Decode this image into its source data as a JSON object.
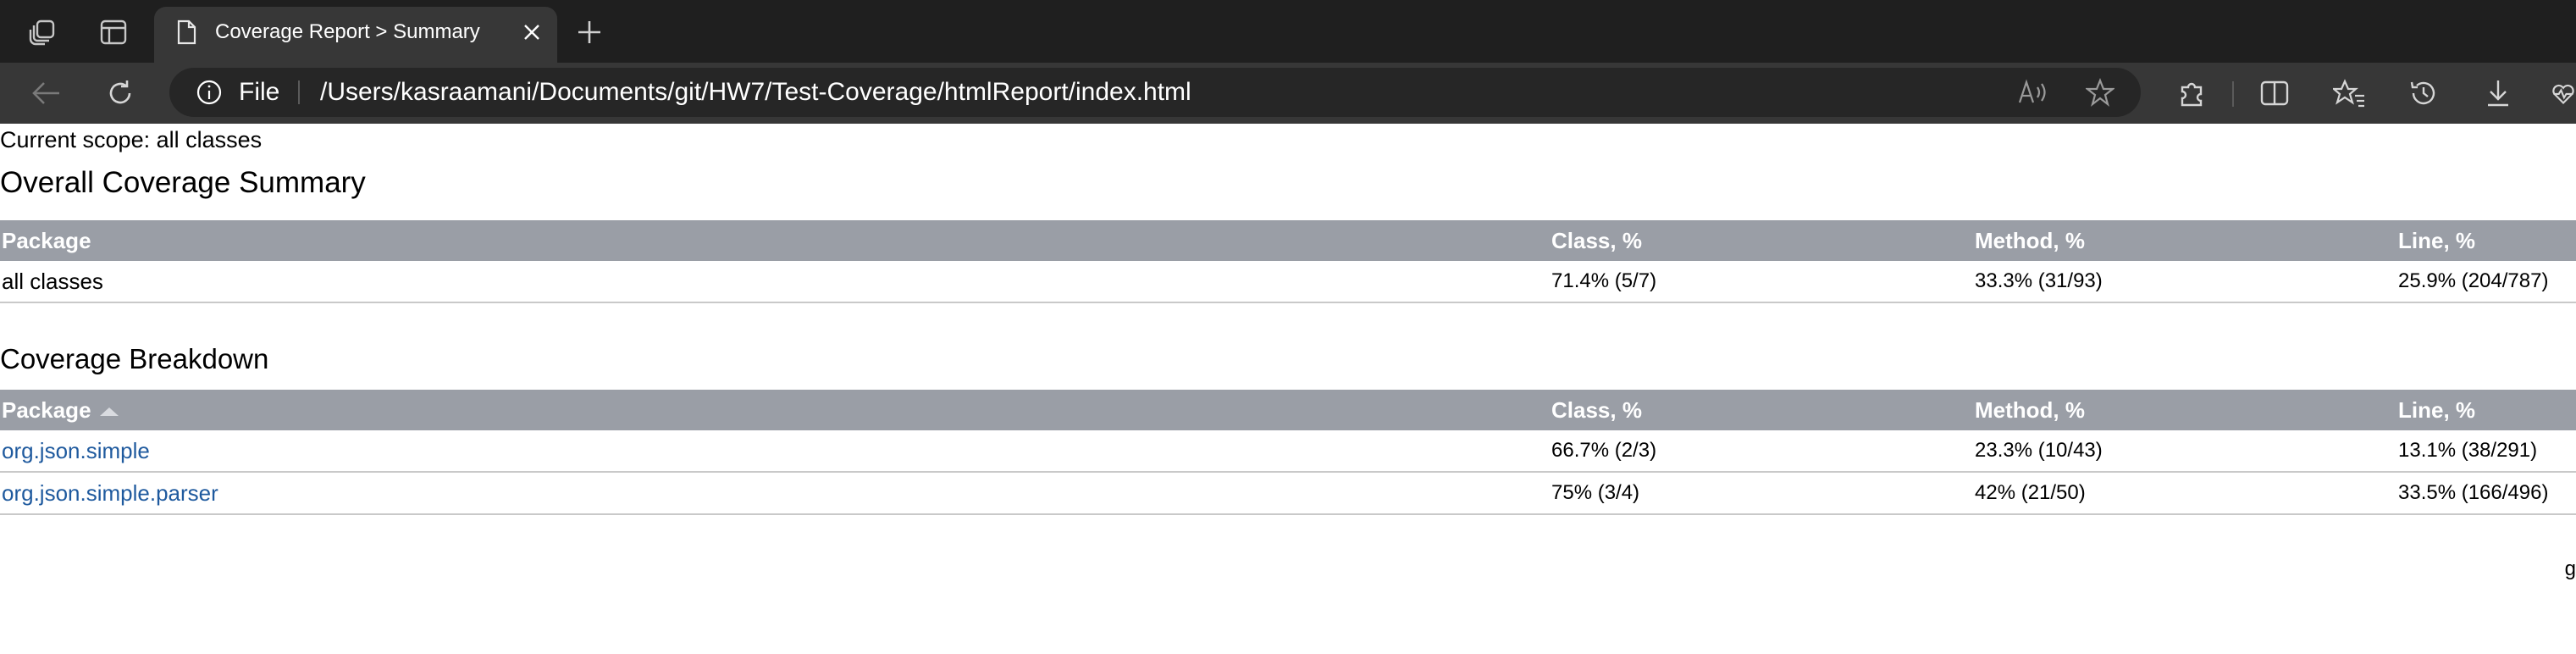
{
  "browser": {
    "tab_title": "Coverage Report > Summary",
    "address_scheme_label": "File",
    "address_url": "/Users/kasraamani/Documents/git/HW7/Test-Coverage/htmlReport/index.html",
    "icons": [
      "workspaces-icon",
      "tab-actions-icon",
      "page-icon",
      "close-icon",
      "new-tab-icon",
      "back-icon",
      "refresh-icon",
      "info-icon",
      "read-aloud-icon",
      "favorite-star-icon",
      "extensions-icon",
      "split-screen-icon",
      "favorites-icon",
      "history-icon",
      "download-icon",
      "heartbeat-icon"
    ]
  },
  "report": {
    "scope_text": "Current scope: all classes",
    "summary_title": "Overall Coverage Summary",
    "summary_headers": [
      "Package",
      "Class, %",
      "Method, %",
      "Line, %"
    ],
    "summary_rows": [
      {
        "package": "all classes",
        "class": "71.4% (5/7)",
        "method": "33.3% (31/93)",
        "line": "25.9% (204/787)"
      }
    ],
    "breakdown_title": "Coverage Breakdown",
    "breakdown_headers": [
      "Package",
      "Class, %",
      "Method, %",
      "Line, %"
    ],
    "breakdown_rows": [
      {
        "package": "org.json.simple",
        "class": "66.7% (2/3)",
        "method": "23.3% (10/43)",
        "line": "13.1% (38/291)"
      },
      {
        "package": "org.json.simple.parser",
        "class": "75% (3/4)",
        "method": "42% (21/50)",
        "line": "33.5% (166/496)"
      }
    ],
    "footer_fragment": "g"
  },
  "colors": {
    "header_bg": "#9a9ea6",
    "link": "#1f5a9e",
    "chrome_dark": "#1f1f1f",
    "chrome_toolbar": "#373737"
  }
}
